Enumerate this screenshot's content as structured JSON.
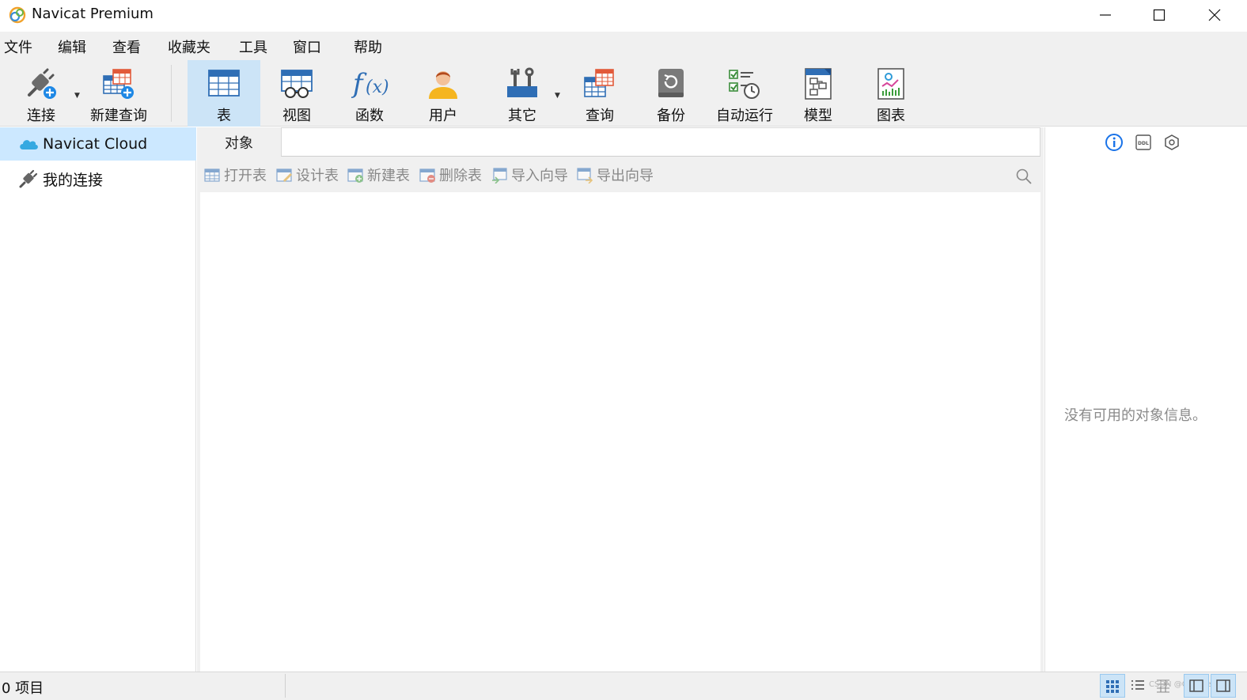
{
  "window": {
    "title": "Navicat Premium"
  },
  "menu": {
    "items": [
      "文件",
      "编辑",
      "查看",
      "收藏夹",
      "工具",
      "窗口",
      "帮助"
    ]
  },
  "toolbar": {
    "connect": "连接",
    "new_query": "新建查询",
    "table": "表",
    "view": "视图",
    "function": "函数",
    "user": "用户",
    "other": "其它",
    "query": "查询",
    "backup": "备份",
    "automation": "自动运行",
    "model": "模型",
    "chart": "图表"
  },
  "sidebar": {
    "items": [
      {
        "label": "Navicat Cloud",
        "icon": "cloud-icon",
        "selected": true
      },
      {
        "label": "我的连接",
        "icon": "plug-icon",
        "selected": false
      }
    ]
  },
  "tabs": {
    "objects": "对象"
  },
  "object_toolbar": {
    "open_table": "打开表",
    "design_table": "设计表",
    "new_table": "新建表",
    "delete_table": "删除表",
    "import_wizard": "导入向导",
    "export_wizard": "导出向导"
  },
  "info_panel": {
    "message": "没有可用的对象信息。",
    "icons": [
      "info-icon",
      "ddl-icon",
      "hexagon-icon"
    ]
  },
  "status": {
    "item_count": "0 项目",
    "watermark": "CSDN @Gdk_Season"
  },
  "colors": {
    "accent": "#1a73e8",
    "selected_bg": "#cce8ff",
    "toolbar_active": "#cce4f7",
    "chrome_bg": "#f0f0f0"
  }
}
